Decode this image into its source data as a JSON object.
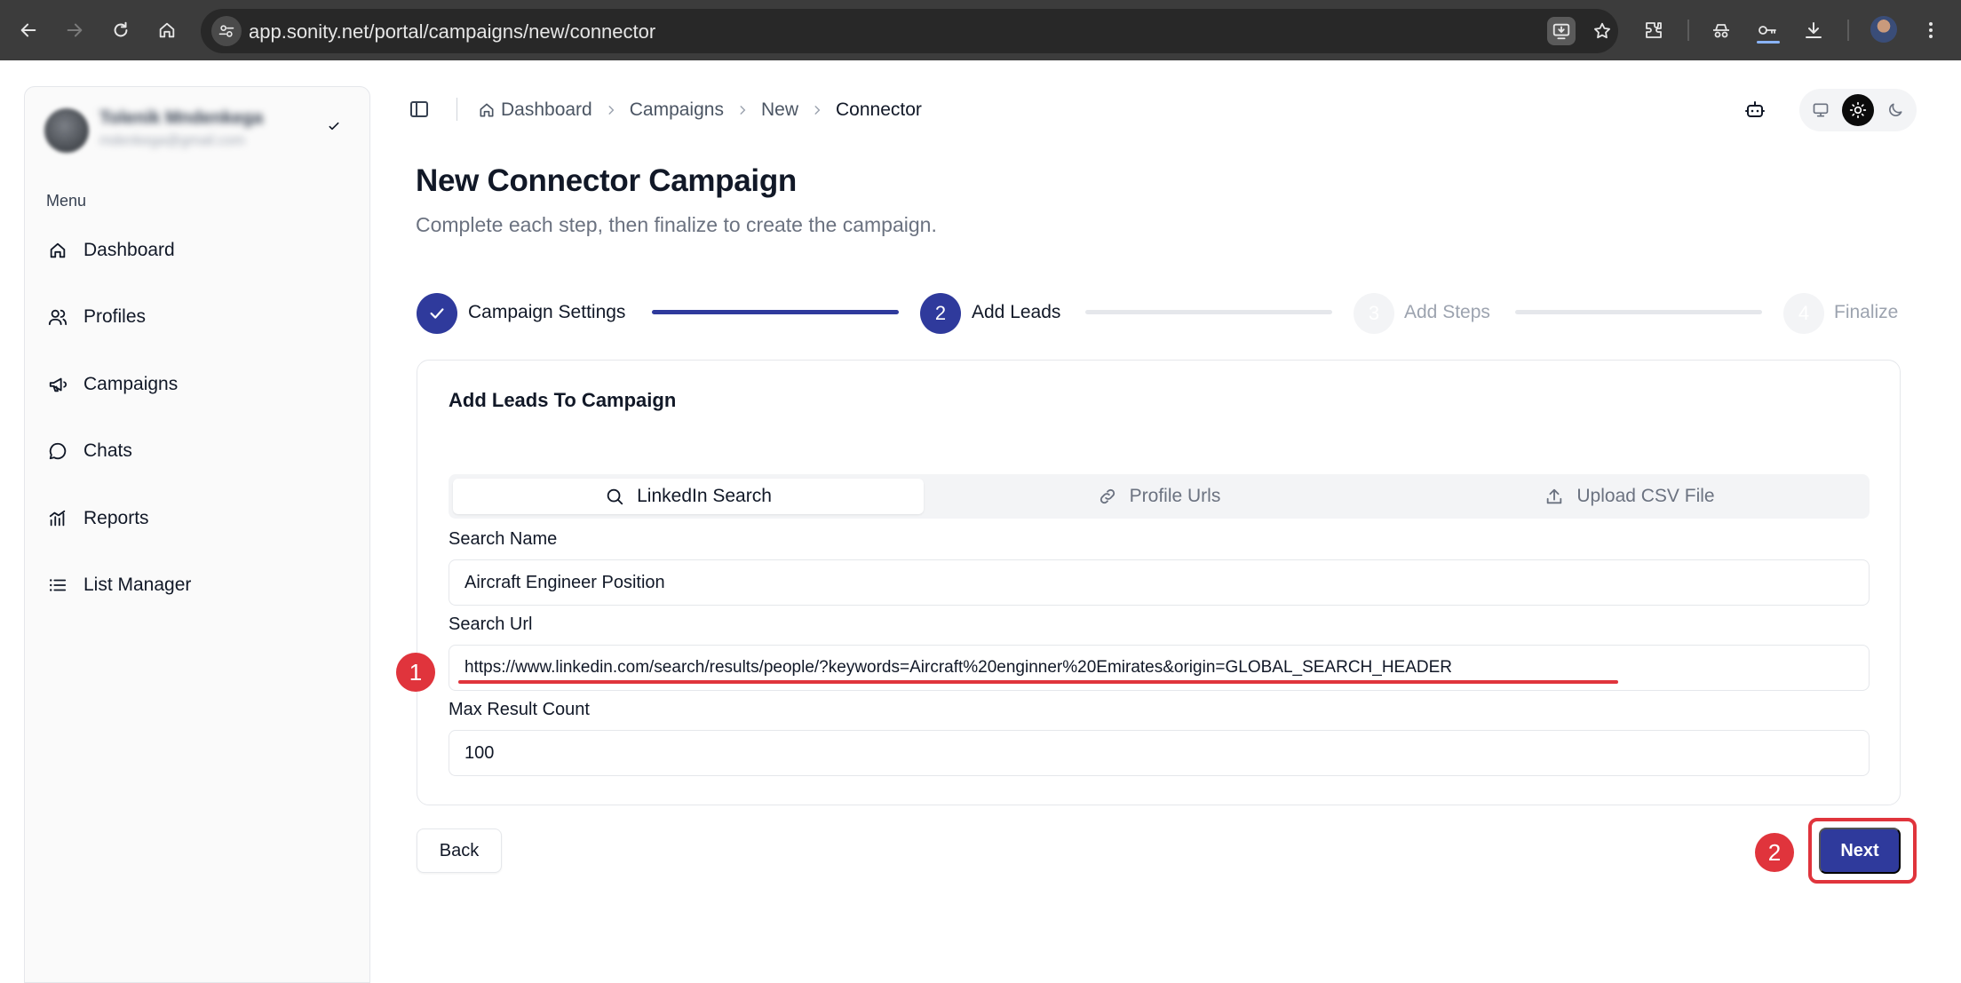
{
  "browser": {
    "url": "app.sonity.net/portal/campaigns/new/connector"
  },
  "sidebar": {
    "user_name": "Tolenik Mndenkega",
    "user_email": "mdenkega@gmail.com",
    "menu_label": "Menu",
    "items": [
      {
        "label": "Dashboard",
        "icon": "home-icon"
      },
      {
        "label": "Profiles",
        "icon": "users-icon"
      },
      {
        "label": "Campaigns",
        "icon": "megaphone-icon"
      },
      {
        "label": "Chats",
        "icon": "chat-bubble-icon"
      },
      {
        "label": "Reports",
        "icon": "chart-icon"
      },
      {
        "label": "List Manager",
        "icon": "list-icon"
      }
    ]
  },
  "breadcrumb": [
    "Dashboard",
    "Campaigns",
    "New",
    "Connector"
  ],
  "page": {
    "title": "New Connector Campaign",
    "subtitle": "Complete each step, then finalize to create the campaign."
  },
  "stepper": {
    "steps": [
      {
        "number": "1",
        "label": "Campaign Settings",
        "state": "done"
      },
      {
        "number": "2",
        "label": "Add Leads",
        "state": "active"
      },
      {
        "number": "3",
        "label": "Add Steps",
        "state": "pending"
      },
      {
        "number": "4",
        "label": "Finalize",
        "state": "pending"
      }
    ]
  },
  "card": {
    "title": "Add Leads To Campaign",
    "tabs": [
      {
        "label": "LinkedIn Search",
        "icon": "search-icon",
        "selected": true
      },
      {
        "label": "Profile Urls",
        "icon": "link-icon",
        "selected": false
      },
      {
        "label": "Upload CSV File",
        "icon": "upload-icon",
        "selected": false
      }
    ],
    "fields": {
      "search_name": {
        "label": "Search Name",
        "value": "Aircraft Engineer Position"
      },
      "search_url": {
        "label": "Search Url",
        "value": "https://www.linkedin.com/search/results/people/?keywords=Aircraft%20enginner%20Emirates&origin=GLOBAL_SEARCH_HEADER"
      },
      "max_result": {
        "label": "Max Result Count",
        "value": "100"
      }
    }
  },
  "buttons": {
    "back": "Back",
    "next": "Next"
  },
  "annotations": {
    "badge_1": "1",
    "badge_2": "2"
  },
  "colors": {
    "primary": "#2f3a9c",
    "annotation": "#e0343c"
  }
}
